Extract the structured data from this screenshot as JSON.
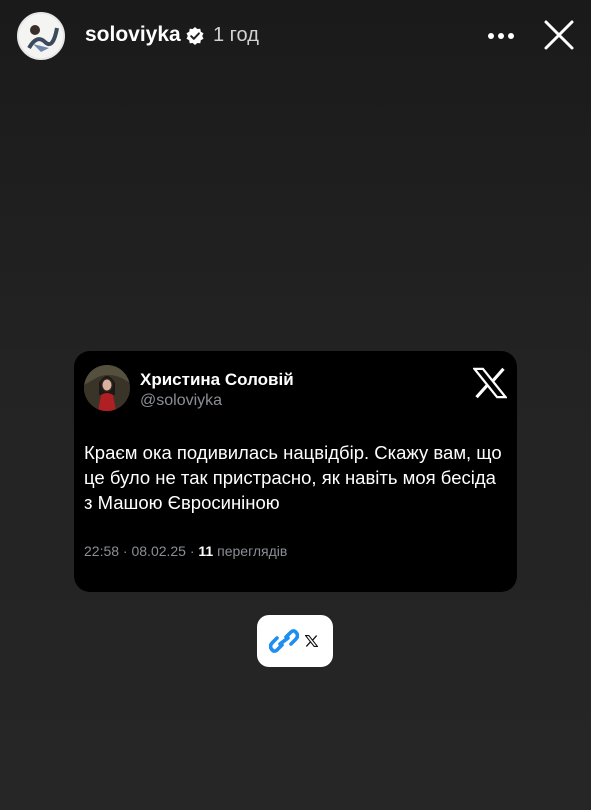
{
  "header": {
    "username": "soloviyka",
    "time_ago": "1 год",
    "icons": {
      "avatar": "avatar",
      "verified": "verified-badge-icon",
      "more": "more-icon",
      "close": "close-icon"
    }
  },
  "tweet": {
    "author_name": "Христина Соловій",
    "author_handle": "@soloviyka",
    "text": "Краєм ока подивилась нацвідбір. Скажу вам, що це було не так пристрасно, як навіть моя бесіда з Машою Євросиніною",
    "time_date": "22:58 · 08.02.25 · ",
    "views_count": "11",
    "views_label": " переглядів",
    "platform_icon": "x-logo-icon"
  },
  "link_sticker": {
    "icons": [
      "link-icon",
      "x-logo-icon"
    ]
  },
  "colors": {
    "background": "#1f1f1f",
    "card": "#000000",
    "muted_text": "#8b8f94",
    "link_blue": "#1e8ef0",
    "verified_badge": "#ffffff"
  }
}
